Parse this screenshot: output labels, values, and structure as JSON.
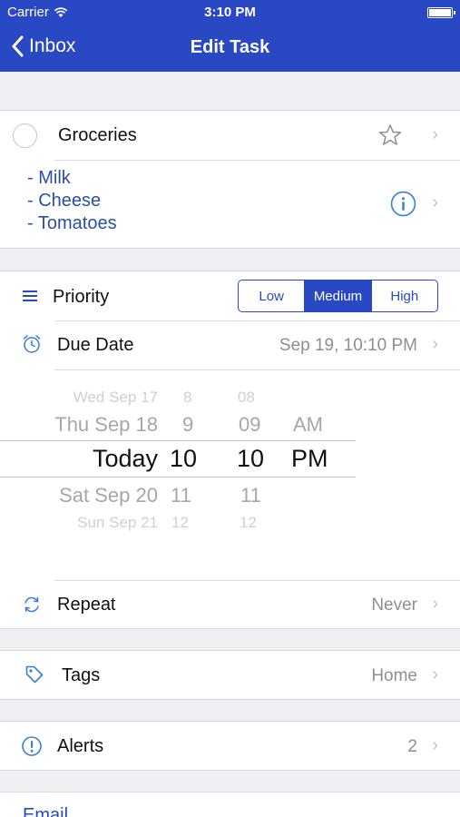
{
  "status": {
    "carrier": "Carrier",
    "time": "3:10 PM"
  },
  "nav": {
    "back_label": "Inbox",
    "title": "Edit Task"
  },
  "task": {
    "title": "Groceries",
    "notes": [
      "- Milk",
      "- Cheese",
      "- Tomatoes"
    ]
  },
  "priority": {
    "label": "Priority",
    "options": [
      "Low",
      "Medium",
      "High"
    ],
    "selected": "Medium"
  },
  "due": {
    "label": "Due Date",
    "value": "Sep 19, 10:10 PM",
    "picker": {
      "days": [
        "Wed Sep 17",
        "Thu Sep 18",
        "Today",
        "Sat Sep 20",
        "Sun Sep 21"
      ],
      "hours": [
        "8",
        "9",
        "10",
        "11",
        "12"
      ],
      "minutes": [
        "08",
        "09",
        "10",
        "11",
        "12"
      ],
      "ampm": [
        "AM",
        "PM"
      ]
    }
  },
  "repeat": {
    "label": "Repeat",
    "value": "Never"
  },
  "tags": {
    "label": "Tags",
    "value": "Home"
  },
  "alerts": {
    "label": "Alerts",
    "value": "2"
  },
  "email": {
    "label": "Email"
  },
  "colors": {
    "brand": "#2949c4",
    "link": "#2a4fa8",
    "icon": "#3a7fd6",
    "gray": "#8e8e93"
  }
}
